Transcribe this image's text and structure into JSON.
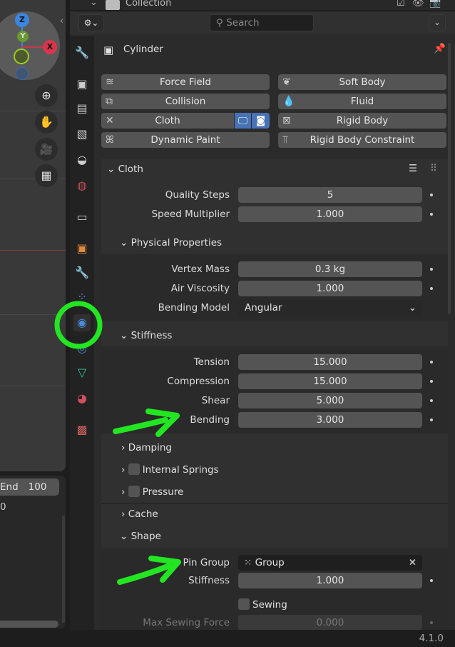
{
  "outliner": {
    "collection_label": "Collection"
  },
  "viewport": {
    "gizmo": {
      "z": "Z",
      "y": "Y",
      "x": "X"
    }
  },
  "timeline": {
    "end_label": "End",
    "end_value": "100",
    "frame_partial": "0"
  },
  "header": {
    "search_placeholder": "Search"
  },
  "object": {
    "name": "Cylinder"
  },
  "physics_buttons": [
    {
      "label": "Force Field",
      "icon": "force-field-icon"
    },
    {
      "label": "Soft Body",
      "icon": "soft-body-icon"
    },
    {
      "label": "Collision",
      "icon": "collision-icon"
    },
    {
      "label": "Fluid",
      "icon": "fluid-icon"
    },
    {
      "label": "Cloth",
      "icon": "close-icon"
    },
    {
      "label": "Rigid Body",
      "icon": "rigid-body-icon"
    },
    {
      "label": "Dynamic Paint",
      "icon": "dynamic-paint-icon"
    },
    {
      "label": "Rigid Body Constraint",
      "icon": "rigid-body-constraint-icon"
    }
  ],
  "cloth": {
    "title": "Cloth",
    "quality_steps": {
      "label": "Quality Steps",
      "value": "5"
    },
    "speed_multiplier": {
      "label": "Speed Multiplier",
      "value": "1.000"
    },
    "physical": {
      "title": "Physical Properties",
      "vertex_mass": {
        "label": "Vertex Mass",
        "value": "0.3 kg"
      },
      "air_viscosity": {
        "label": "Air Viscosity",
        "value": "1.000"
      },
      "bending_model": {
        "label": "Bending Model",
        "value": "Angular"
      }
    },
    "stiffness": {
      "title": "Stiffness",
      "tension": {
        "label": "Tension",
        "value": "15.000"
      },
      "compression": {
        "label": "Compression",
        "value": "15.000"
      },
      "shear": {
        "label": "Shear",
        "value": "5.000"
      },
      "bending": {
        "label": "Bending",
        "value": "3.000"
      }
    },
    "damping": "Damping",
    "internal_springs": "Internal Springs",
    "pressure": "Pressure",
    "cache": "Cache",
    "shape": {
      "title": "Shape",
      "pin_group": {
        "label": "Pin Group",
        "value": "Group"
      },
      "stiffness": {
        "label": "Stiffness",
        "value": "1.000"
      },
      "sewing": "Sewing",
      "max_sewing_force": {
        "label": "Max Sewing Force",
        "value": "0.000"
      }
    }
  },
  "status": {
    "version": "4.1.0"
  },
  "colors": {
    "accent": "#4772b3",
    "annotation": "#22e622"
  }
}
